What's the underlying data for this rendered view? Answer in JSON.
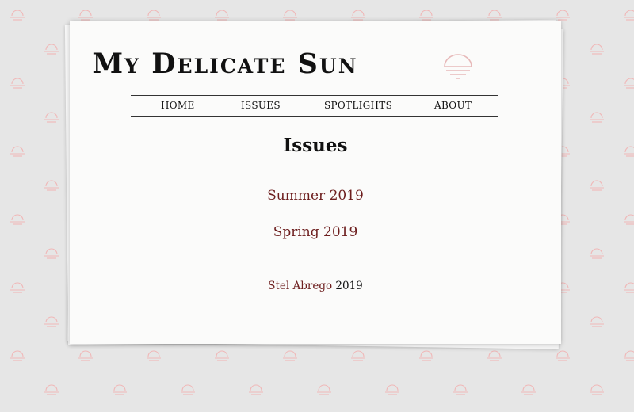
{
  "site": {
    "title": "My Delicate Sun",
    "logo_icon": "sunset-icon",
    "accent_color": "#6d1e1e",
    "logo_color": "#e7b9b9"
  },
  "nav": {
    "items": [
      {
        "label": "HOME"
      },
      {
        "label": "ISSUES"
      },
      {
        "label": "SPOTLIGHTS"
      },
      {
        "label": "ABOUT"
      }
    ]
  },
  "main": {
    "heading": "Issues",
    "issues": [
      {
        "label": "Summer 2019"
      },
      {
        "label": "Spring 2019"
      }
    ]
  },
  "footer": {
    "author": "Stel Abrego",
    "year": "2019"
  },
  "background": {
    "pattern_icon": "sunset-icon",
    "pattern_color": "#f0b8b8"
  }
}
